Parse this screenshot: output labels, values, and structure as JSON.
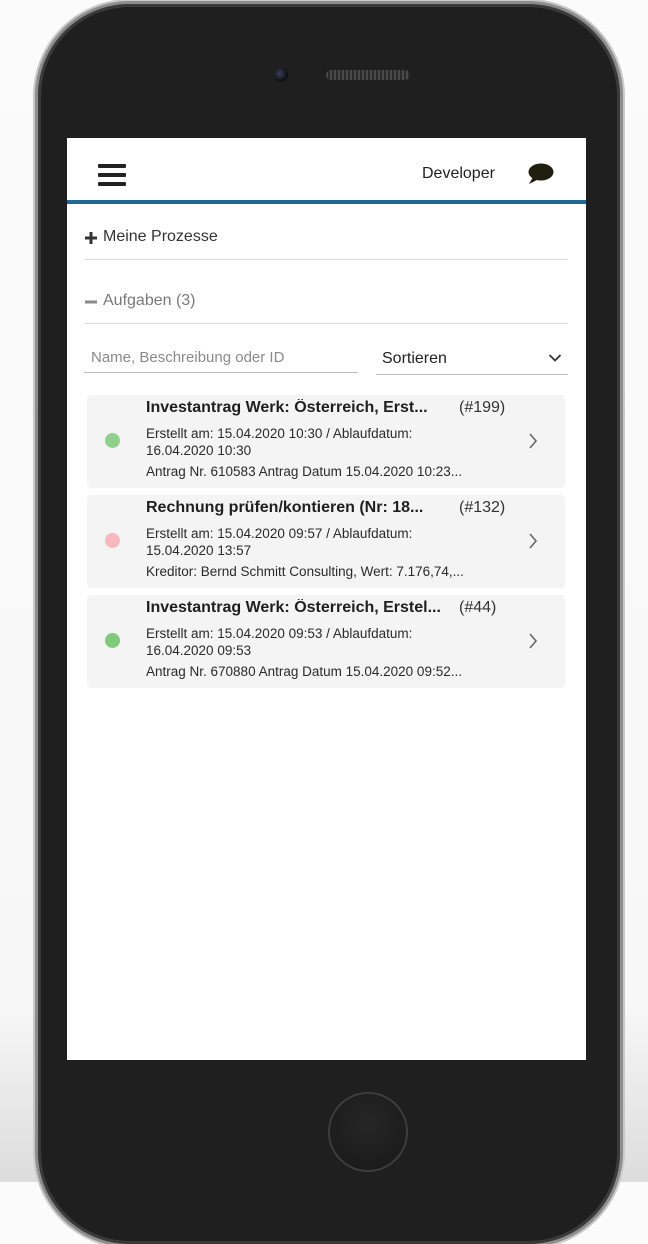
{
  "header": {
    "menu_icon": "hamburger-icon",
    "user_name": "Developer",
    "chat_icon": "speech-bubble-icon"
  },
  "sections": {
    "processes": {
      "label": "Meine Prozesse",
      "icon": "plus-icon",
      "expanded": false
    },
    "tasks": {
      "label": "Aufgaben (3)",
      "icon": "minus-icon",
      "expanded": true
    }
  },
  "filter": {
    "search_placeholder": "Name, Beschreibung oder ID",
    "search_value": "",
    "sort_label": "Sortieren"
  },
  "tasks": [
    {
      "title": "Investantrag Werk: Österreich, Erst...",
      "id": "(#199)",
      "dates": "Erstellt am: 15.04.2020 10:30 / Ablaufdatum: 16.04.2020 10:30",
      "extra": "Antrag Nr. 610583 Antrag Datum 15.04.2020 10:23...",
      "status_color": "#8fd08a"
    },
    {
      "title": "Rechnung prüfen/kontieren (Nr: 18...",
      "id": "(#132)",
      "dates": "Erstellt am: 15.04.2020 09:57 / Ablaufdatum: 15.04.2020 13:57",
      "extra": "Kreditor: Bernd Schmitt Consulting, Wert: 7.176,74,...",
      "status_color": "#f7b9bd"
    },
    {
      "title": "Investantrag Werk: Österreich, Erstel...",
      "id": "(#44)",
      "dates": "Erstellt am: 15.04.2020 09:53 / Ablaufdatum: 16.04.2020 09:53",
      "extra": "Antrag Nr. 670880 Antrag Datum 15.04.2020 09:52...",
      "status_color": "#7fc97a"
    }
  ],
  "colors": {
    "accent": "#1e6a94",
    "card_bg": "#f4f4f4"
  }
}
